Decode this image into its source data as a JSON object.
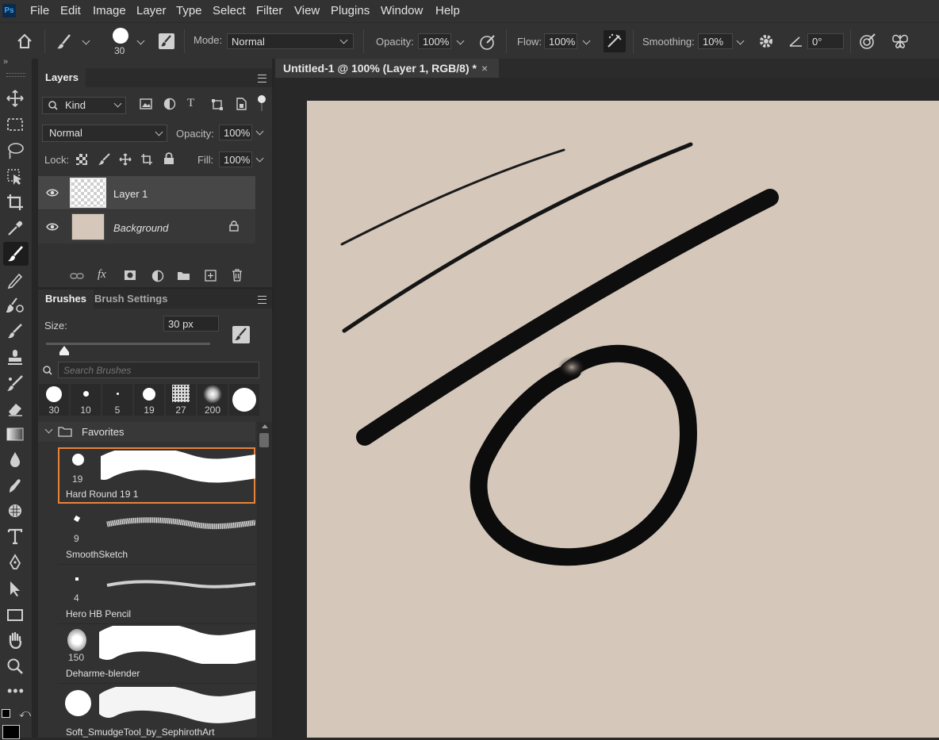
{
  "menu": {
    "logo": "Ps",
    "items": [
      "File",
      "Edit",
      "Image",
      "Layer",
      "Type",
      "Select",
      "Filter",
      "View",
      "Plugins",
      "Window",
      "Help"
    ]
  },
  "options": {
    "brush_size": "30",
    "mode_label": "Mode:",
    "mode_value": "Normal",
    "opacity_label": "Opacity:",
    "opacity_value": "100%",
    "flow_label": "Flow:",
    "flow_value": "100%",
    "smoothing_label": "Smoothing:",
    "smoothing_value": "10%",
    "angle_value": "0°"
  },
  "layers_panel": {
    "tab": "Layers",
    "filter_kind": "Kind",
    "blend_mode": "Normal",
    "opacity_label": "Opacity:",
    "opacity_value": "100%",
    "lock_label": "Lock:",
    "fill_label": "Fill:",
    "fill_value": "100%",
    "layers": [
      {
        "name": "Layer 1",
        "selected": true
      },
      {
        "name": "Background",
        "locked": true
      }
    ]
  },
  "brushes_panel": {
    "tabs": [
      "Brushes",
      "Brush Settings"
    ],
    "size_label": "Size:",
    "size_value": "30 px",
    "size_fraction": 0.06,
    "search_placeholder": "Search Brushes",
    "recent_presets": [
      "30",
      "10",
      "5",
      "19",
      "27",
      "200"
    ],
    "folder": "Favorites",
    "items": [
      {
        "size": "19",
        "name": "Hard Round 19 1",
        "selected": true
      },
      {
        "size": "9",
        "name": "SmoothSketch"
      },
      {
        "size": "4",
        "name": "Hero HB Pencil"
      },
      {
        "size": "150",
        "name": "Deharme-blender"
      },
      {
        "size": "",
        "name": "Soft_SmudgeTool_by_SephirothArt"
      }
    ]
  },
  "document": {
    "tab_title": "Untitled-1 @ 100% (Layer 1, RGB/8) *",
    "canvas_color": "#d5c8bb"
  },
  "colors": {
    "accent_selected": "#e8823a",
    "panel_bg": "#323232"
  }
}
